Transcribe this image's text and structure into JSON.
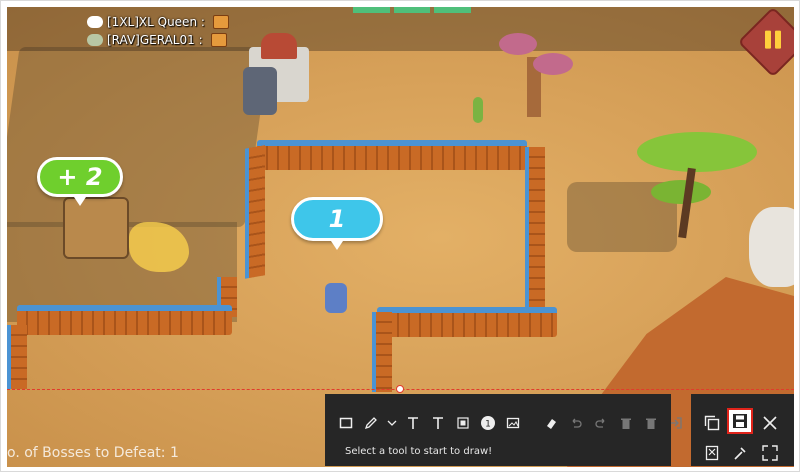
{
  "chat": [
    {
      "name": "[1XL]XL Queen :"
    },
    {
      "name": "[RAV]GERAL01 :"
    }
  ],
  "bubbles": {
    "reward": "+ 2",
    "waypoint": "1"
  },
  "hud": {
    "bosses_text": "o. of Bosses to Defeat: 1"
  },
  "toolbar": {
    "tools": [
      "rectangle-icon",
      "pen-icon",
      "chevron-down-icon",
      "text-icon",
      "text-box-icon",
      "mosaic-icon",
      "step-number-icon",
      "image-icon",
      "eraser-icon",
      "undo-icon",
      "redo-icon",
      "delete-icon",
      "clear-all-icon",
      "exit-edit-icon"
    ],
    "hint": "Select a tool to start to draw!"
  },
  "actions": [
    "copy-icon",
    "save-icon",
    "close-icon",
    "pin-icon",
    "eyedropper-icon",
    "fullscreen-icon"
  ],
  "colors": {
    "selection_border": "#e23b2c",
    "toolbar_bg": "#262626",
    "save_highlight": "#e0241b",
    "reward_bubble": "#6fcf2d",
    "waypoint_bubble": "#3ec6ea",
    "fence_top": "#4b93d3",
    "fence_log": "#c96a25"
  }
}
